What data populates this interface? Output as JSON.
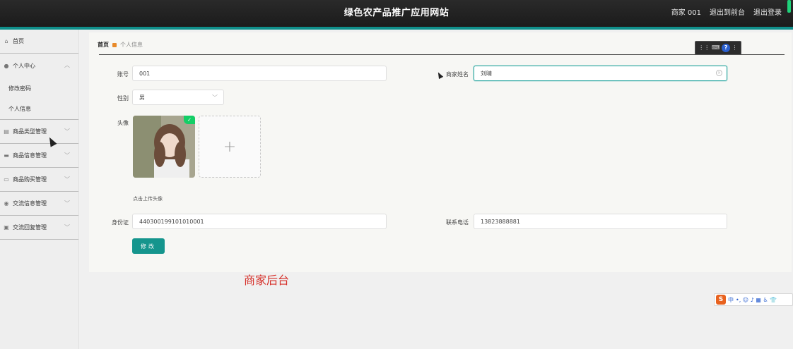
{
  "header": {
    "title": "绿色农产品推广应用网站",
    "user_label": "商家 001",
    "front_link": "退出到前台",
    "logout_link": "退出登录"
  },
  "sidebar": {
    "items": [
      {
        "label": "首页",
        "icon": "home-icon"
      },
      {
        "label": "个人中心",
        "icon": "user-icon",
        "expanded": true,
        "children": [
          "修改密码",
          "个人信息"
        ]
      },
      {
        "label": "商品类型管理",
        "icon": "folder-icon"
      },
      {
        "label": "商品信息管理",
        "icon": "monitor-icon"
      },
      {
        "label": "商品购买管理",
        "icon": "ticket-icon"
      },
      {
        "label": "交流信息管理",
        "icon": "pin-icon"
      },
      {
        "label": "交流回复管理",
        "icon": "chat-icon"
      }
    ]
  },
  "breadcrumb": {
    "home": "首页",
    "current": "个人信息"
  },
  "form": {
    "account_label": "账号",
    "account_value": "001",
    "name_label": "商家姓名",
    "name_value": "刘晴",
    "gender_label": "性别",
    "gender_value": "男",
    "avatar_label": "头像",
    "avatar_hint": "点击上传头像",
    "id_label": "身份证",
    "id_value": "440300199101010001",
    "phone_label": "联系电话",
    "phone_value": "13823888881",
    "submit_label": "修改",
    "upload_plus": "+"
  },
  "overlay_caption": "商家后台",
  "ime": {
    "logo": "S",
    "mode": "中",
    "symbols": "•, ☺ ♪ ▦ ♿ 👕"
  },
  "toolbar": {
    "keyboard": "⌨",
    "help": "?"
  },
  "colors": {
    "accent": "#15958d",
    "header_bg": "#1f1f1f",
    "caption": "#d6302a"
  }
}
